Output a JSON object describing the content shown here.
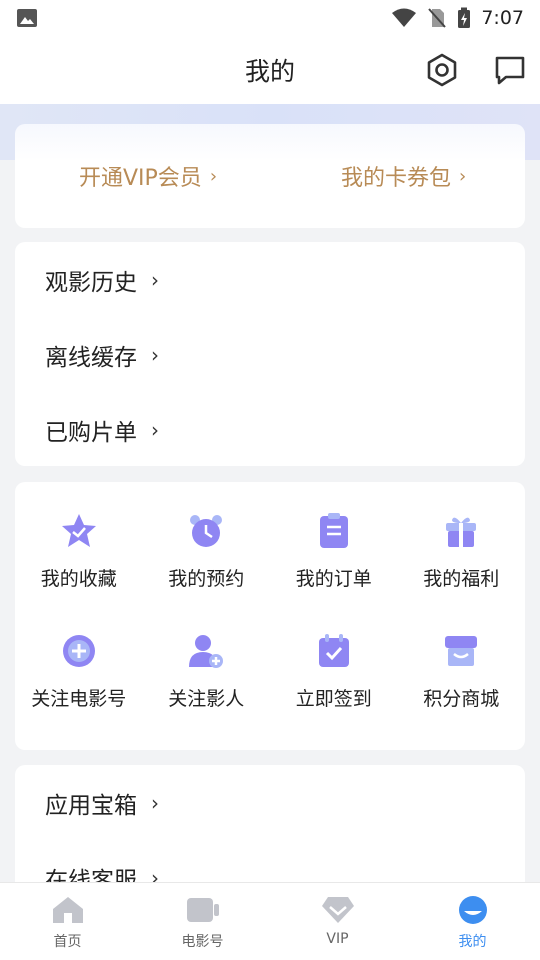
{
  "status_bar": {
    "time": "7:07"
  },
  "header": {
    "title": "我的"
  },
  "vip": {
    "open_vip_label": "开通VIP会员",
    "coupon_label": "我的卡券包",
    "chevron": "›"
  },
  "section1": {
    "items": [
      {
        "label": "观影历史"
      },
      {
        "label": "离线缓存"
      },
      {
        "label": "已购片单"
      }
    ]
  },
  "grid": {
    "items": [
      {
        "label": "我的收藏",
        "icon": "star-icon"
      },
      {
        "label": "我的预约",
        "icon": "alarm-clock-icon"
      },
      {
        "label": "我的订单",
        "icon": "clipboard-icon"
      },
      {
        "label": "我的福利",
        "icon": "gift-icon"
      },
      {
        "label": "关注电影号",
        "icon": "add-badge-icon"
      },
      {
        "label": "关注影人",
        "icon": "add-person-icon"
      },
      {
        "label": "立即签到",
        "icon": "calendar-check-icon"
      },
      {
        "label": "积分商城",
        "icon": "store-icon"
      }
    ]
  },
  "section3": {
    "items": [
      {
        "label": "应用宝箱"
      },
      {
        "label": "在线客服"
      }
    ]
  },
  "tabbar": {
    "items": [
      {
        "label": "首页"
      },
      {
        "label": "电影号"
      },
      {
        "label": "VIP"
      },
      {
        "label": "我的"
      }
    ],
    "active": "我的"
  },
  "colors": {
    "accent": "#3d8ef0",
    "vip_gold": "#b88b56",
    "icon_purple": "#8f86f3",
    "icon_blue": "#7aa7f6"
  }
}
